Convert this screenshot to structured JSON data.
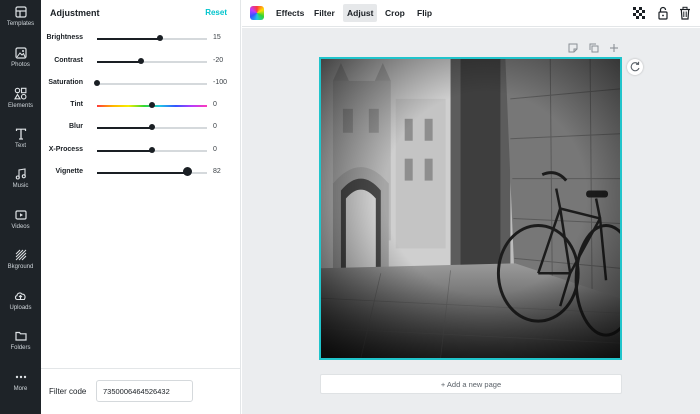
{
  "sidebar": {
    "items": [
      {
        "label": "Templates",
        "icon": "templates-icon"
      },
      {
        "label": "Photos",
        "icon": "photos-icon"
      },
      {
        "label": "Elements",
        "icon": "elements-icon"
      },
      {
        "label": "Text",
        "icon": "text-icon"
      },
      {
        "label": "Music",
        "icon": "music-icon"
      },
      {
        "label": "Videos",
        "icon": "videos-icon"
      },
      {
        "label": "Bkground",
        "icon": "background-icon"
      },
      {
        "label": "Uploads",
        "icon": "uploads-icon"
      },
      {
        "label": "Folders",
        "icon": "folders-icon"
      },
      {
        "label": "More",
        "icon": "more-icon"
      }
    ]
  },
  "panel": {
    "title": "Adjustment",
    "reset_label": "Reset",
    "accent_color": "#00c4cc",
    "sliders": [
      {
        "label": "Brightness",
        "value": "15",
        "fraction": 0.575
      },
      {
        "label": "Contrast",
        "value": "-20",
        "fraction": 0.4
      },
      {
        "label": "Saturation",
        "value": "-100",
        "fraction": 0.0
      },
      {
        "label": "Tint",
        "value": "0",
        "fraction": 0.5
      },
      {
        "label": "Blur",
        "value": "0",
        "fraction": 0.5
      },
      {
        "label": "X-Process",
        "value": "0",
        "fraction": 0.5
      },
      {
        "label": "Vignette",
        "value": "82",
        "fraction": 0.82
      }
    ],
    "filter_code_label": "Filter code",
    "filter_code_value": "7350006464526432"
  },
  "toolbar": {
    "tabs": [
      "Effects",
      "Filter",
      "Adjust",
      "Crop",
      "Flip"
    ],
    "active_tab": "Adjust",
    "right_icons": [
      "transparency-icon",
      "lock-icon",
      "trash-icon"
    ]
  },
  "canvas": {
    "page_tool_icons": [
      "note-icon",
      "duplicate-icon",
      "add-icon"
    ],
    "selection_color": "#20c4cb",
    "add_page_label": "+ Add a new page"
  }
}
